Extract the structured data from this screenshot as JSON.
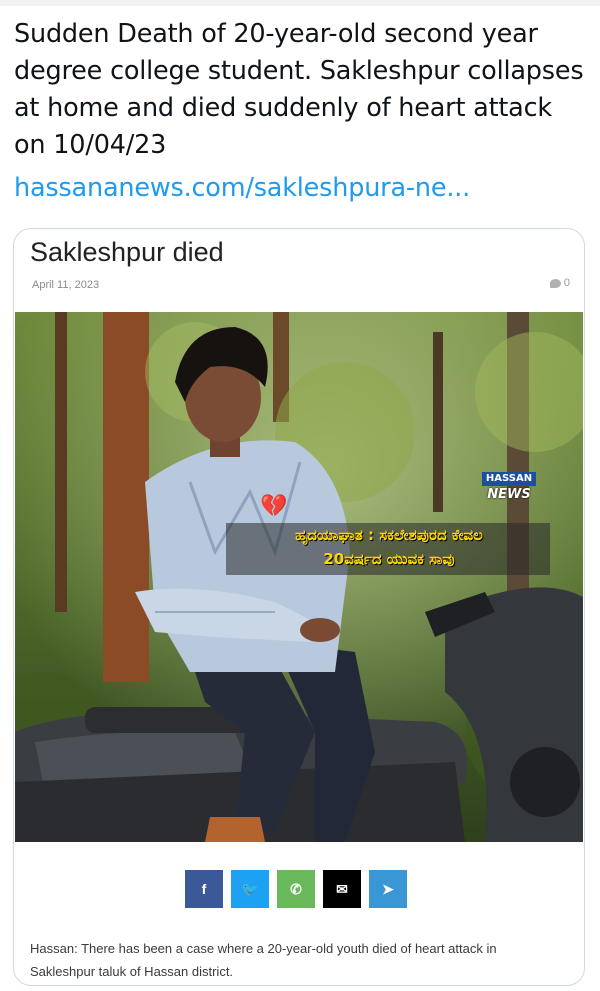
{
  "post": {
    "text": "Sudden Death of 20-year-old second year degree college student. Sakleshpur collapses at home and died suddenly of heart attack on 10/04/23",
    "link": "hassananews.com/sakleshpura-ne..."
  },
  "card": {
    "title": "Sakleshpur died",
    "date": "April 11, 2023",
    "comment_count": "0",
    "image": {
      "logo_line1": "HASSAN",
      "logo_line2": "NEWS",
      "headline_line1": "ಹೃದಯಾಘಾತ : ಸಕಲೇಶಪುರದ ಕೇವಲ",
      "headline_line2": "20ವರ್ಷದ ಯುವಕ ಸಾವು",
      "heart_emoji": "💔"
    },
    "share": [
      {
        "name": "facebook-icon",
        "glyph": "f",
        "color": "#3b5998"
      },
      {
        "name": "twitter-icon",
        "glyph": "🐦",
        "color": "#1da1f2"
      },
      {
        "name": "whatsapp-icon",
        "glyph": "✆",
        "color": "#69b95b"
      },
      {
        "name": "email-icon",
        "glyph": "✉",
        "color": "#000000"
      },
      {
        "name": "telegram-icon",
        "glyph": "➤",
        "color": "#3a97d6"
      }
    ],
    "excerpt": "Hassan: There has been a case where a 20-year-old youth died of heart attack in Sakleshpur taluk of Hassan district."
  }
}
